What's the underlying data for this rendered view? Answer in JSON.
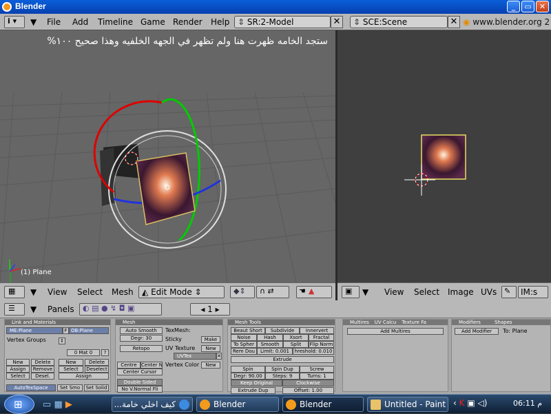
{
  "window": {
    "title": "Blender"
  },
  "header": {
    "menus": [
      "File",
      "Add",
      "Timeline",
      "Game",
      "Render",
      "Help"
    ],
    "screen": "SR:2-Model",
    "scene": "SCE:Scene",
    "url": "www.blender.org 2"
  },
  "viewport3d": {
    "annotation": "ستجد الخامه ظهرت هنا ولم تظهر في الجهه الخلفيه وهذا صحيح ١٠٠%",
    "object_label": "(1) Plane",
    "menus": [
      "View",
      "Select",
      "Mesh"
    ],
    "mode": "Edit Mode"
  },
  "uv_editor": {
    "menus": [
      "View",
      "Select",
      "Image",
      "UVs"
    ],
    "image_field": "IM:s"
  },
  "buttons": {
    "panels_label": "Panels",
    "frame": "1",
    "link": {
      "title": "Link and Materials",
      "me": "ME:Plane",
      "f": "F",
      "ob": "OB:Plane",
      "vertex_groups": "Vertex Groups",
      "mat": "0 Mat 0",
      "q": "?",
      "new": "New",
      "delete": "Delete",
      "assign": "Assign",
      "remove": "Remove",
      "select": "Select",
      "desel": "Desel.",
      "new2": "New",
      "delete2": "Delete",
      "select2": "Select",
      "deselect2": "Deselect",
      "assign2": "Assign",
      "autotex": "AutoTexSpace",
      "setsmo": "Set Smo",
      "setsolid": "Set Solid"
    },
    "mesh": {
      "title": "Mesh",
      "auto_smooth": "Auto Smooth",
      "degr": "Degr: 30",
      "retopo": "Retopo",
      "center_new": "Centre",
      "center_ne": "Center Ne",
      "center_cursor": "Center Cursor",
      "double_sided": "Double Sided",
      "no_vnormal": "No V.Normal Fli",
      "texmesh": "TexMesh:",
      "sticky": "Sticky",
      "make": "Make",
      "uv_texture": "UV Texture",
      "new": "New",
      "uvtex": "UVTex",
      "vertex_color": "Vertex Color",
      "new2": "New"
    },
    "tools": {
      "title": "Mesh Tools",
      "beauty": "Beaut Short",
      "subdivide": "Subdivide",
      "innervert": "Innervert",
      "noise": "Noise",
      "hash": "Hash",
      "xsort": "Xsort",
      "fractal": "Fractal",
      "tospher": "To Spher",
      "smooth": "Smooth",
      "split": "Split",
      "flipnorm": "Flip Norm",
      "remdou": "Rem Dou",
      "limit": "Limit: 0.001",
      "threshold": "hreshold: 0.010",
      "extrude": "Extrude",
      "spin": "Spin",
      "spindup": "Spin Dup",
      "screw": "Screw",
      "degr": "Degr: 90.00",
      "steps": "Steps: 9",
      "turns": "Turns: 1",
      "keep": "Keep Original",
      "clockwise": "Clockwise",
      "extrudedup": "Extrude Dup",
      "offset": "Offset: 1.00"
    },
    "multires": {
      "tab1": "Multires",
      "tab2": "UV Calcu",
      "tab3": "Texture Fa",
      "add": "Add Multires"
    },
    "modifiers": {
      "tab1": "Modifiers",
      "tab2": "Shapes",
      "add": "Add Modifier",
      "to": "To: Plane"
    }
  },
  "taskbar": {
    "tasks": [
      "كيف اخلي خامة...",
      "Blender",
      "Blender",
      "Untitled - Paint"
    ],
    "clock": "06:11 م"
  },
  "colors": {
    "titlebar": "#0a5fd8",
    "viewport": "#666666",
    "uv_bg": "#3f3f3f",
    "taskbar": "#1b3454"
  }
}
